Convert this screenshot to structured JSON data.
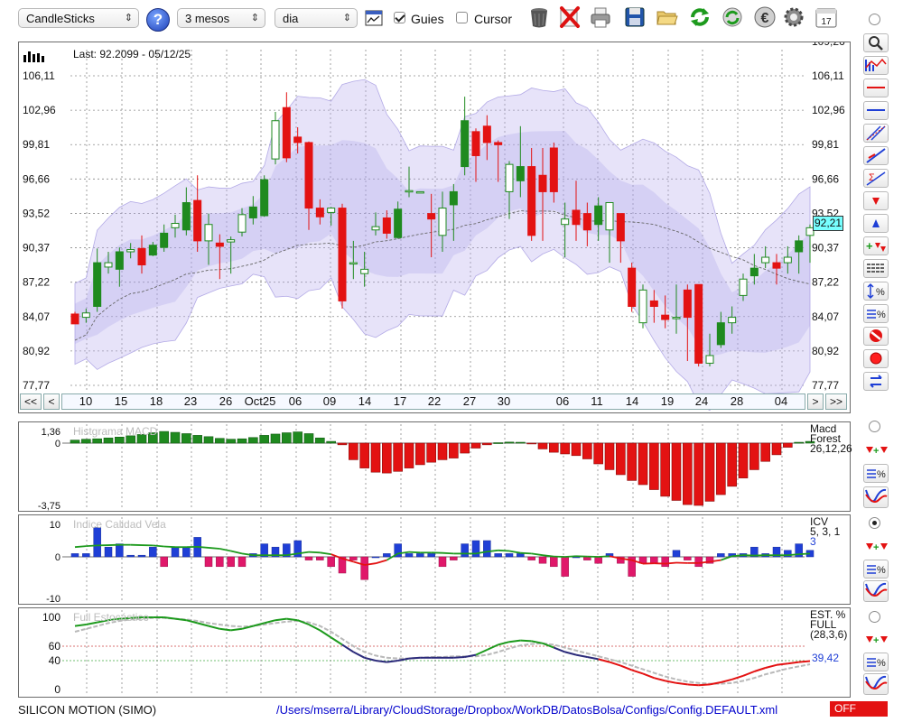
{
  "toolbar": {
    "chart_type": "CandleSticks",
    "period": "3 mesos",
    "interval": "dia",
    "guides_label": "Guies",
    "guides_checked": true,
    "cursor_label": "Cursor",
    "cursor_checked": false,
    "help_glyph": "?",
    "calendar_day": "17",
    "icons": [
      "help-icon",
      "chart-settings-icon",
      "trash-icon",
      "delete-icon",
      "print-icon",
      "save-icon",
      "open-folder-icon",
      "refresh-icon",
      "update-icon",
      "euro-icon",
      "settings-gear-icon",
      "calendar-icon"
    ]
  },
  "main_chart": {
    "last_label": "Last: 92.2099 - 05/12/25",
    "current_price": "92,21",
    "y_ticks": [
      "106,11",
      "102,96",
      "99,81",
      "96,66",
      "93,52",
      "90,37",
      "87,22",
      "84,07",
      "80,92",
      "77,77"
    ],
    "top_cut_tick": "109,26",
    "x_ticks": [
      "10",
      "15",
      "18",
      "23",
      "26",
      "Oct25",
      "06",
      "09",
      "14",
      "17",
      "22",
      "27",
      "30",
      "06",
      "11",
      "14",
      "19",
      "24",
      "28",
      "04"
    ],
    "nav": {
      "first": "<<",
      "prev": "<",
      "next": ">",
      "last": ">>"
    }
  },
  "macd": {
    "title": "Histgrama MACD",
    "label_lines": [
      "Macd",
      "Forest",
      "26,12,26"
    ],
    "y_ticks": [
      "1,36",
      "0",
      "-3,75"
    ]
  },
  "icv": {
    "title": "Indice Calidad Vela",
    "label_lines": [
      "ICV",
      "5, 3, 1"
    ],
    "param": "3",
    "y_ticks": [
      "10",
      "0",
      "-10"
    ]
  },
  "stochastic": {
    "title": "Full Estocástico",
    "label_lines": [
      "EST. %",
      "FULL",
      "(28,3,6)"
    ],
    "value": "39,42",
    "y_ticks": [
      "100",
      "60",
      "40",
      "0"
    ]
  },
  "status": {
    "symbol": "SILICON MOTION (SIMO)",
    "path": "/Users/mserra/Library/CloudStorage/Dropbox/WorkDB/DatosBolsa/Configs/Config.DEFAULT.xml",
    "state": "OFF"
  },
  "right_tools": [
    "zoom-icon",
    "indicator-chart-icon",
    "horizontal-line-icon",
    "horizontal-line-blue-icon",
    "trend-channel-icon",
    "trend-line-icon",
    "fibonacci-icon",
    "sell-arrow-icon",
    "buy-arrow-icon",
    "signals-icon",
    "lines-list-icon",
    "scale-percent-icon",
    "levels-percent-icon",
    "remove-icon",
    "record-icon",
    "swap-icon"
  ],
  "colors": {
    "up": "#1f8a1f",
    "down": "#e31212",
    "band": "#b9b0ee",
    "blue": "#1f3fd6",
    "pink": "#e0186a",
    "accent": "#0000cc"
  },
  "chart_data": {
    "type": "candlestick",
    "y_range": [
      77.77,
      109.26
    ],
    "x_labels": [
      "10",
      "15",
      "18",
      "23",
      "26",
      "Oct25",
      "06",
      "09",
      "14",
      "17",
      "22",
      "27",
      "30",
      "06",
      "11",
      "14",
      "19",
      "24",
      "28",
      "04"
    ],
    "last_value": 92.2099
  }
}
